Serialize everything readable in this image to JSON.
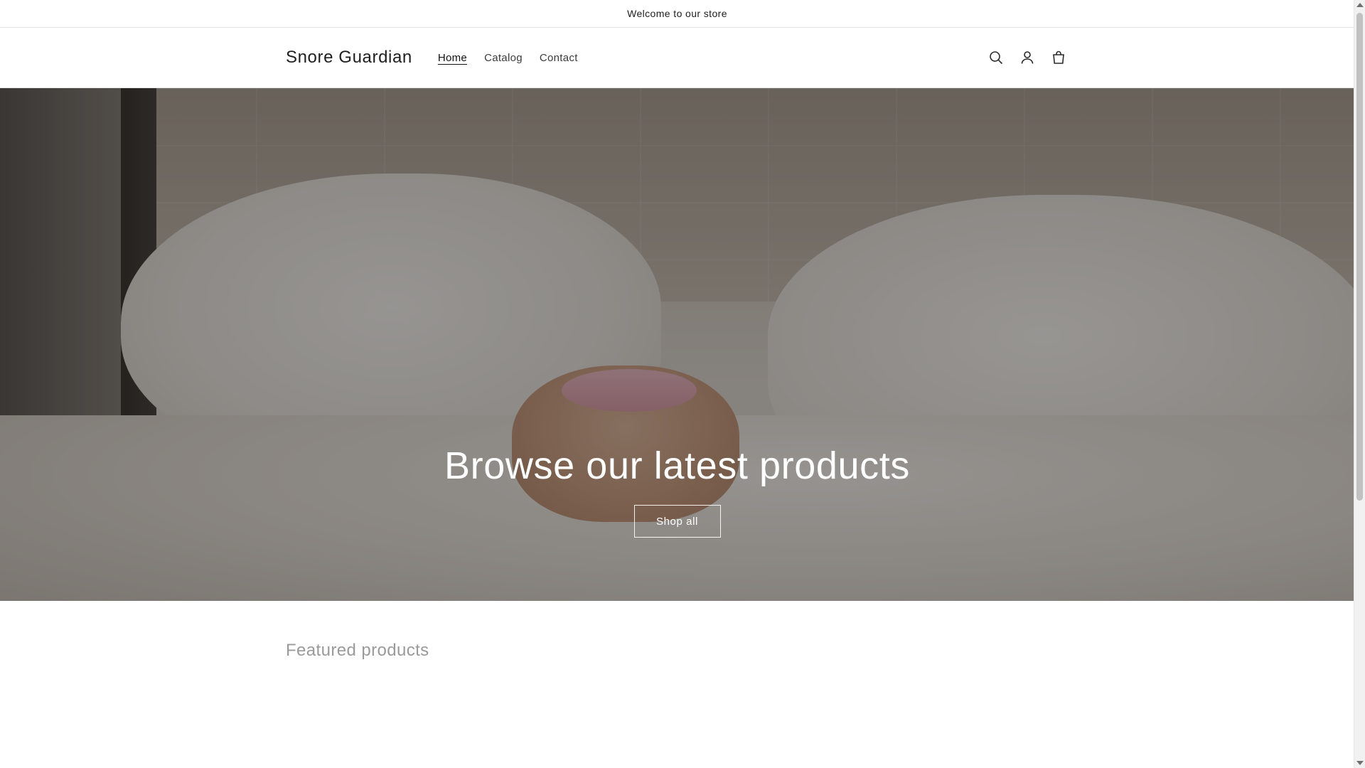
{
  "announcement": {
    "text": "Welcome to our store"
  },
  "header": {
    "brand": "Snore Guardian",
    "nav": [
      {
        "label": "Home",
        "active": true
      },
      {
        "label": "Catalog",
        "active": false
      },
      {
        "label": "Contact",
        "active": false
      }
    ],
    "icons": [
      "search-icon",
      "account-icon",
      "cart-icon"
    ]
  },
  "hero": {
    "title": "Browse our latest products",
    "button_label": "Shop all"
  },
  "featured": {
    "title": "Featured products"
  },
  "colors": {
    "text": "#121212",
    "muted": "#9a9a9a",
    "border": "#e6e6e6",
    "hero_overlay": "rgba(0,0,0,0.38)"
  }
}
